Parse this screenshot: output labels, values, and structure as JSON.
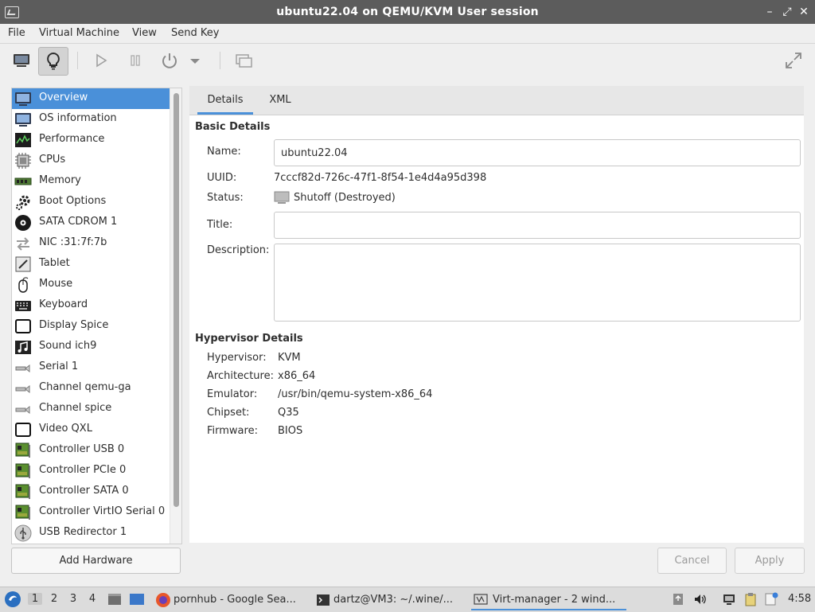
{
  "window": {
    "title": "ubuntu22.04 on QEMU/KVM User session"
  },
  "menubar": [
    "File",
    "Virtual Machine",
    "View",
    "Send Key"
  ],
  "toolbar": {
    "icons": [
      "console-icon",
      "details-lightbulb-icon",
      "run-icon",
      "pause-icon",
      "power-icon",
      "dropdown-icon",
      "snapshots-icon",
      "fullscreen-icon"
    ]
  },
  "sidebar": {
    "items": [
      {
        "label": "Overview",
        "icon": "overview-icon"
      },
      {
        "label": "OS information",
        "icon": "monitor-icon"
      },
      {
        "label": "Performance",
        "icon": "performance-icon"
      },
      {
        "label": "CPUs",
        "icon": "cpu-icon"
      },
      {
        "label": "Memory",
        "icon": "memory-icon"
      },
      {
        "label": "Boot Options",
        "icon": "gear-icon"
      },
      {
        "label": "SATA CDROM 1",
        "icon": "cdrom-icon"
      },
      {
        "label": "NIC :31:7f:7b",
        "icon": "network-icon"
      },
      {
        "label": "Tablet",
        "icon": "tablet-icon"
      },
      {
        "label": "Mouse",
        "icon": "mouse-icon"
      },
      {
        "label": "Keyboard",
        "icon": "keyboard-icon"
      },
      {
        "label": "Display Spice",
        "icon": "display-icon"
      },
      {
        "label": "Sound ich9",
        "icon": "sound-icon"
      },
      {
        "label": "Serial 1",
        "icon": "serial-icon"
      },
      {
        "label": "Channel qemu-ga",
        "icon": "channel-icon"
      },
      {
        "label": "Channel spice",
        "icon": "channel-icon"
      },
      {
        "label": "Video QXL",
        "icon": "video-icon"
      },
      {
        "label": "Controller USB 0",
        "icon": "controller-icon"
      },
      {
        "label": "Controller PCIe 0",
        "icon": "controller-icon"
      },
      {
        "label": "Controller SATA 0",
        "icon": "controller-icon"
      },
      {
        "label": "Controller VirtIO Serial 0",
        "icon": "controller-icon"
      },
      {
        "label": "USB Redirector 1",
        "icon": "usb-icon"
      }
    ],
    "selected_index": 0,
    "add_hardware": "Add Hardware"
  },
  "tabs": [
    "Details",
    "XML"
  ],
  "basic": {
    "heading": "Basic Details",
    "name_label": "Name:",
    "name_value": "ubuntu22.04",
    "uuid_label": "UUID:",
    "uuid_value": "7cccf82d-726c-47f1-8f54-1e4d4a95d398",
    "status_label": "Status:",
    "status_value": "Shutoff (Destroyed)",
    "title_label": "Title:",
    "title_value": "",
    "description_label": "Description:",
    "description_value": ""
  },
  "hypervisor": {
    "heading": "Hypervisor Details",
    "rows": [
      {
        "label": "Hypervisor:",
        "value": "KVM"
      },
      {
        "label": "Architecture:",
        "value": "x86_64"
      },
      {
        "label": "Emulator:",
        "value": "/usr/bin/qemu-system-x86_64"
      },
      {
        "label": "Chipset:",
        "value": "Q35"
      },
      {
        "label": "Firmware:",
        "value": "BIOS"
      }
    ]
  },
  "buttons": {
    "cancel": "Cancel",
    "apply": "Apply"
  },
  "taskbar": {
    "workspaces": [
      "1",
      "2",
      "3",
      "4"
    ],
    "tasks": [
      {
        "label": "pornhub - Google Sea...",
        "icon": "firefox-icon"
      },
      {
        "label": "dartz@VM3: ~/.wine/...",
        "icon": "terminal-icon"
      },
      {
        "label": "Virt-manager - 2 wind...",
        "icon": "virt-manager-icon"
      }
    ],
    "clock": "4:58"
  },
  "colors": {
    "accent": "#4a90d9",
    "titlebar": "#5c5c5c"
  }
}
